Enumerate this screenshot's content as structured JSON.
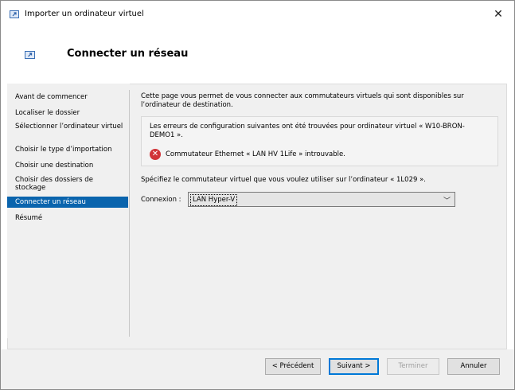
{
  "window": {
    "title": "Importer un ordinateur virtuel",
    "close_glyph": "✕"
  },
  "header": {
    "title": "Connecter un réseau"
  },
  "nav": {
    "items": [
      {
        "label": "Avant de commencer"
      },
      {
        "label": "Localiser le dossier"
      },
      {
        "label": "Sélectionner l’ordinateur virtuel"
      },
      {
        "label": "Choisir le type d’importation"
      },
      {
        "label": "Choisir une destination"
      },
      {
        "label": "Choisir des dossiers de stockage"
      },
      {
        "label": "Connecter un réseau",
        "active": true
      },
      {
        "label": "Résumé"
      }
    ]
  },
  "main": {
    "description": "Cette page vous permet de vous connecter aux commutateurs virtuels qui sont disponibles sur l’ordinateur de destination.",
    "error_box": {
      "intro": "Les erreurs de configuration suivantes ont été trouvées pour ordinateur virtuel « W10-BRON-DEMO1 ».",
      "icon": "error-icon",
      "message": "Commutateur Ethernet « LAN HV 1Life » introuvable."
    },
    "specify_text": "Spécifiez le commutateur virtuel que vous voulez utiliser sur l’ordinateur « 1L029 ».",
    "connection_label": "Connexion :",
    "connection_value": "LAN Hyper-V"
  },
  "footer": {
    "previous": "< Précédent",
    "next": "Suivant >",
    "finish": "Terminer",
    "cancel": "Annuler"
  },
  "colors": {
    "accent": "#0a64ad",
    "error": "#d13438"
  }
}
